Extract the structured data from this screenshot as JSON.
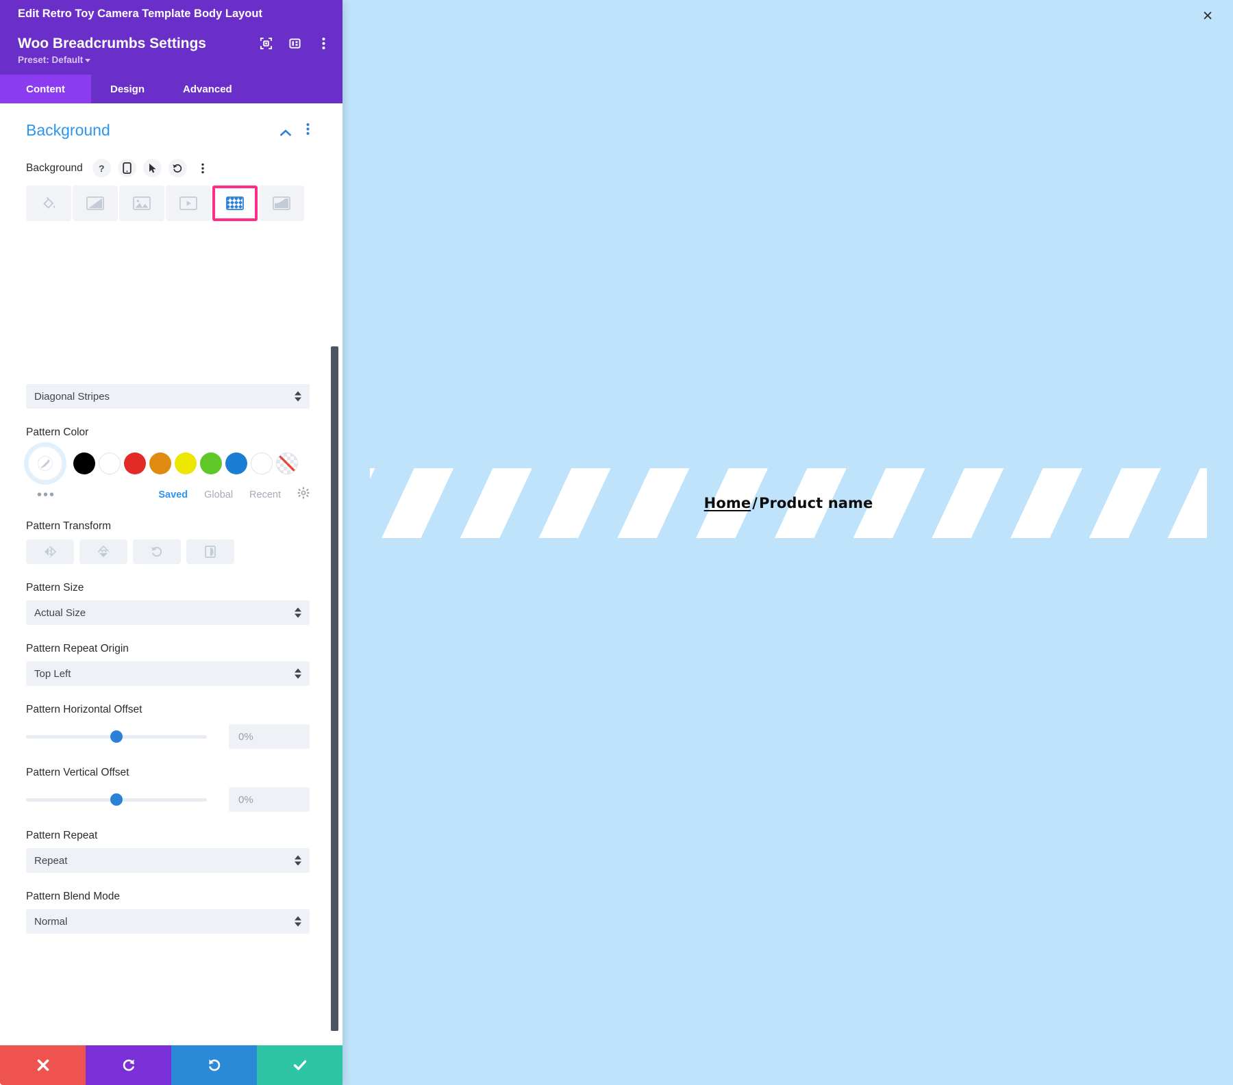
{
  "window": {
    "document_title": "Edit Retro Toy Camera Template Body Layout",
    "close_label": "×"
  },
  "module": {
    "title": "Woo Breadcrumbs Settings",
    "preset_label": "Preset: Default",
    "header_icons": [
      {
        "name": "focus-module-icon"
      },
      {
        "name": "layout-panel-icon"
      },
      {
        "name": "module-menu-icon"
      }
    ]
  },
  "tabs": [
    {
      "label": "Content",
      "active": true
    },
    {
      "label": "Design",
      "active": false
    },
    {
      "label": "Advanced",
      "active": false
    }
  ],
  "section": {
    "title": "Background",
    "collapse_icon": "chevron-up-icon",
    "menu_icon": "vertical-dots-icon"
  },
  "background_control": {
    "label": "Background",
    "utility_icons": [
      {
        "name": "help-icon",
        "glyph": "?"
      },
      {
        "name": "responsive-phone-icon"
      },
      {
        "name": "hover-cursor-icon"
      },
      {
        "name": "reset-icon"
      },
      {
        "name": "options-dots-icon"
      }
    ],
    "types": [
      {
        "name": "background-color",
        "label": "Color",
        "selected": false
      },
      {
        "name": "background-gradient",
        "label": "Gradient",
        "selected": false
      },
      {
        "name": "background-image",
        "label": "Image",
        "selected": false
      },
      {
        "name": "background-video",
        "label": "Video",
        "selected": false
      },
      {
        "name": "background-pattern",
        "label": "Pattern",
        "selected": true
      },
      {
        "name": "background-mask",
        "label": "Mask",
        "selected": false
      }
    ],
    "selected_highlight_color": "#ff2d87"
  },
  "pattern": {
    "style_value": "Diagonal Stripes",
    "color_label": "Pattern Color",
    "swatches": [
      {
        "name": "eyedropper",
        "color": ""
      },
      {
        "name": "black",
        "color": "#000000"
      },
      {
        "name": "white",
        "color": "#ffffff"
      },
      {
        "name": "red",
        "color": "#e02b27"
      },
      {
        "name": "orange",
        "color": "#df8a11"
      },
      {
        "name": "yellow",
        "color": "#ece600"
      },
      {
        "name": "green",
        "color": "#5fc828"
      },
      {
        "name": "blue",
        "color": "#1a7fd4"
      },
      {
        "name": "white-outline",
        "color": "#ffffff"
      },
      {
        "name": "transparent",
        "color": "transparent"
      }
    ],
    "palette_tabs": [
      {
        "label": "Saved",
        "active": true
      },
      {
        "label": "Global",
        "active": false
      },
      {
        "label": "Recent",
        "active": false
      }
    ],
    "palette_more": "•••",
    "transform_label": "Pattern Transform",
    "transforms": [
      {
        "name": "flip-horizontal-icon"
      },
      {
        "name": "flip-vertical-icon"
      },
      {
        "name": "rotate-icon"
      },
      {
        "name": "invert-icon"
      }
    ],
    "size_label": "Pattern Size",
    "size_value": "Actual Size",
    "repeat_origin_label": "Pattern Repeat Origin",
    "repeat_origin_value": "Top Left",
    "h_offset_label": "Pattern Horizontal Offset",
    "h_offset_value": "0%",
    "v_offset_label": "Pattern Vertical Offset",
    "v_offset_value": "0%",
    "repeat_label": "Pattern Repeat",
    "repeat_value": "Repeat",
    "blend_label": "Pattern Blend Mode",
    "blend_value": "Normal"
  },
  "actions": [
    {
      "name": "cancel-button",
      "icon": "close-x-icon",
      "color": "#ef5350"
    },
    {
      "name": "undo-button",
      "icon": "undo-arrow-icon",
      "color": "#7b2fd6"
    },
    {
      "name": "redo-button",
      "icon": "redo-arrow-icon",
      "color": "#2b8ad8"
    },
    {
      "name": "save-button",
      "icon": "check-icon",
      "color": "#2ec4a6"
    }
  ],
  "preview": {
    "breadcrumb_home": "Home",
    "breadcrumb_separator": "/",
    "breadcrumb_current": "Product name",
    "canvas_color": "#bfe3fb",
    "pattern_color": "#ffffff"
  }
}
